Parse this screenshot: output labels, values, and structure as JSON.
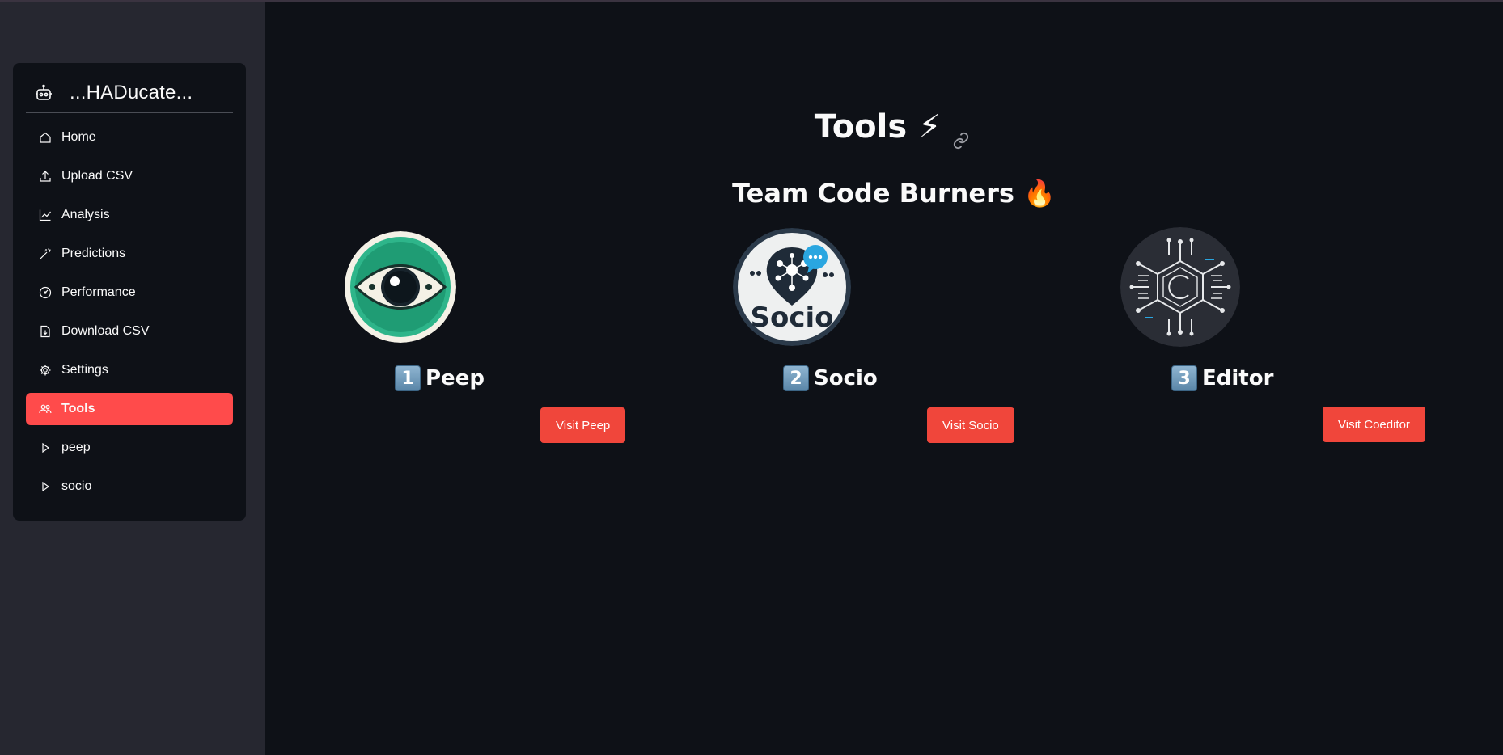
{
  "app": {
    "title": "...HADucate..."
  },
  "sidebar": {
    "items": [
      {
        "label": "Home",
        "icon": "home-icon"
      },
      {
        "label": "Upload CSV",
        "icon": "upload-icon"
      },
      {
        "label": "Analysis",
        "icon": "line-chart-icon"
      },
      {
        "label": "Predictions",
        "icon": "magic-wand-icon"
      },
      {
        "label": "Performance",
        "icon": "speedometer-icon"
      },
      {
        "label": "Download CSV",
        "icon": "file-download-icon"
      },
      {
        "label": "Settings",
        "icon": "gear-icon"
      },
      {
        "label": "Tools",
        "icon": "people-icon",
        "active": true
      },
      {
        "label": "peep",
        "icon": "play-icon"
      },
      {
        "label": "socio",
        "icon": "play-icon"
      }
    ]
  },
  "main": {
    "title": "Tools",
    "title_emoji": "⚡",
    "subtitle": "Team Code Burners 🔥",
    "tools": [
      {
        "number": "1",
        "name": "Peep",
        "button": "Visit Peep",
        "logo": "eye-logo-icon"
      },
      {
        "number": "2",
        "name": "Socio",
        "button": "Visit Socio",
        "logo": "socio-logo-icon",
        "logo_text": "Socio"
      },
      {
        "number": "3",
        "name": "Editor",
        "button": "Visit Coeditor",
        "logo": "circuit-logo-icon"
      }
    ]
  },
  "colors": {
    "accent": "#ff4b4b",
    "button": "#f0463b",
    "background": "#0e1117",
    "sidebar": "#262730"
  }
}
